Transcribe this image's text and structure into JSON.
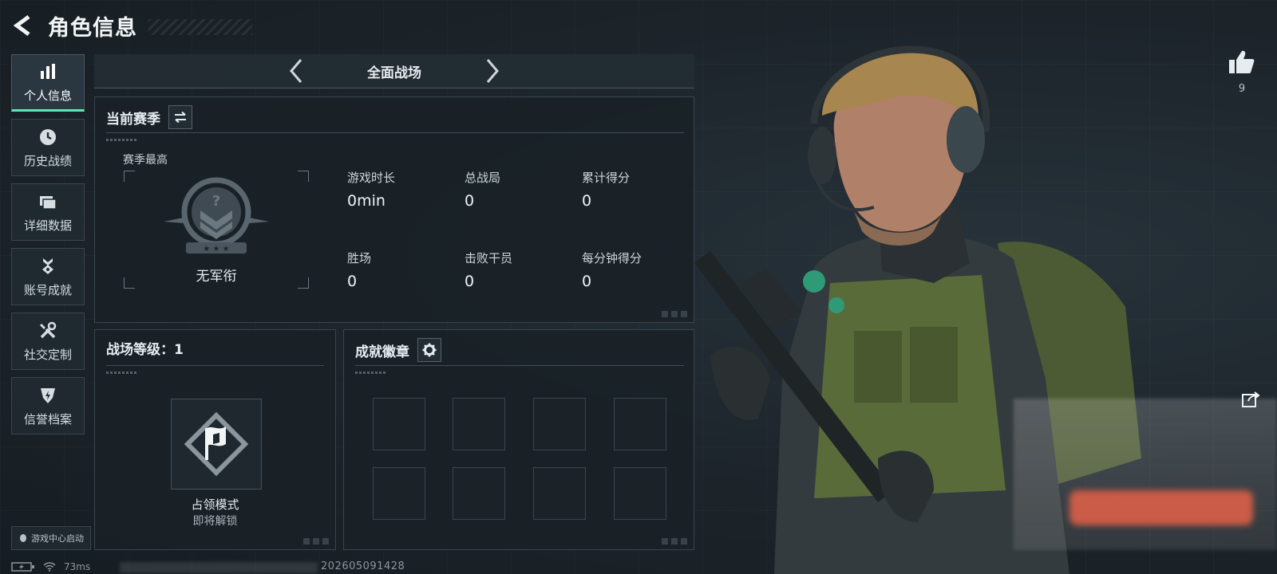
{
  "header": {
    "title": "角色信息",
    "back_icon": "arrow-left-icon"
  },
  "sidebar": {
    "items": [
      {
        "label": "个人信息",
        "icon": "bar-chart-icon",
        "active": true
      },
      {
        "label": "历史战绩",
        "icon": "clock-history-icon",
        "active": false
      },
      {
        "label": "详细数据",
        "icon": "folder-icon",
        "active": false
      },
      {
        "label": "账号成就",
        "icon": "medal-icon",
        "active": false
      },
      {
        "label": "社交定制",
        "icon": "tools-icon",
        "active": false
      },
      {
        "label": "信誉档案",
        "icon": "shield-bolt-icon",
        "active": false
      }
    ],
    "game_center_label": "游戏中心启动"
  },
  "mode": {
    "title": "全面战场"
  },
  "season": {
    "title": "当前赛季",
    "best_label": "赛季最高",
    "rank_name": "无军衔",
    "stats": [
      {
        "label": "游戏时长",
        "value": "0min"
      },
      {
        "label": "总战局",
        "value": "0"
      },
      {
        "label": "累计得分",
        "value": "0"
      },
      {
        "label": "胜场",
        "value": "0"
      },
      {
        "label": "击败干员",
        "value": "0"
      },
      {
        "label": "每分钟得分",
        "value": "0"
      }
    ]
  },
  "level": {
    "title": "战场等级：1",
    "mode_name": "占领模式",
    "lock_text": "即将解锁"
  },
  "badges": {
    "title": "成就徽章",
    "slot_count": 8
  },
  "social": {
    "like_count": "9"
  },
  "status_bar": {
    "ping": "73ms",
    "build_id": "202605091428"
  },
  "colors": {
    "accent": "#5ee8b0",
    "panel_border": "#39444c",
    "background": "#1b2329"
  }
}
